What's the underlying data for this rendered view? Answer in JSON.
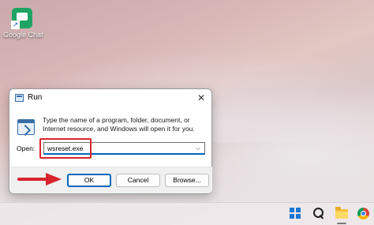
{
  "desktop": {
    "icons": [
      {
        "label": "Google Chat",
        "icon": "google-chat-icon"
      }
    ]
  },
  "run_dialog": {
    "title": "Run",
    "close_glyph": "✕",
    "description": "Type the name of a program, folder, document, or Internet resource, and Windows will open it for you.",
    "open_label": "Open:",
    "open_value": "wsreset.exe",
    "dropdown_glyph": "⌵",
    "buttons": {
      "ok": "OK",
      "cancel": "Cancel",
      "browse": "Browse..."
    }
  },
  "annotation": {
    "highlight_color": "#d9242b",
    "arrow_color": "#d9242b"
  },
  "taskbar": {
    "items": [
      "windows-start-icon",
      "search-icon",
      "file-explorer-icon",
      "chrome-icon"
    ]
  },
  "colors": {
    "accent": "#0067c0"
  }
}
